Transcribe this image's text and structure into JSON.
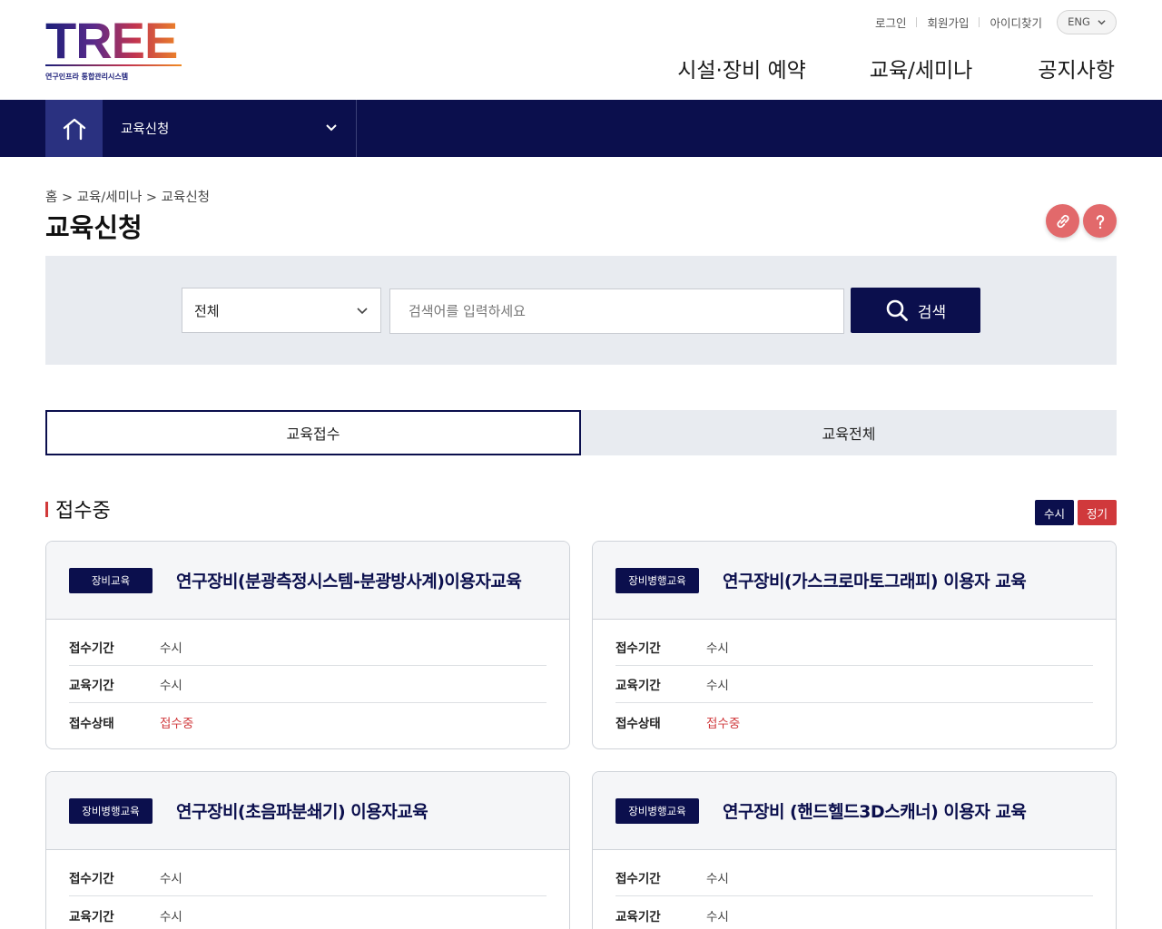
{
  "logo": {
    "word": "TREE",
    "subtitle": "연구인프라 통합관리시스템"
  },
  "util_links": [
    "로그인",
    "회원가입",
    "아이디찾기"
  ],
  "language": "ENG",
  "gnb": [
    "시설·장비 예약",
    "교육/세미나",
    "공지사항"
  ],
  "subnav": {
    "selected": "교육신청"
  },
  "breadcrumb": "홈 > 교육/세미나 > 교육신청",
  "page_title": "교육신청",
  "search": {
    "category": "전체",
    "placeholder": "검색어를 입력하세요",
    "button": "검색"
  },
  "tabs": [
    "교육접수",
    "교육전체"
  ],
  "section": {
    "title": "접수중",
    "legend": [
      "수시",
      "정기"
    ]
  },
  "cards": [
    {
      "tag": "장비교육",
      "title": "연구장비(분광측정시스템-분광방사계)이용자교육",
      "rows": [
        {
          "label": "접수기간",
          "value": "수시"
        },
        {
          "label": "교육기간",
          "value": "수시"
        },
        {
          "label": "접수상태",
          "value": "접수중"
        }
      ]
    },
    {
      "tag": "장비병행교육",
      "title": "연구장비(가스크로마토그래피) 이용자 교육",
      "rows": [
        {
          "label": "접수기간",
          "value": "수시"
        },
        {
          "label": "교육기간",
          "value": "수시"
        },
        {
          "label": "접수상태",
          "value": "접수중"
        }
      ]
    },
    {
      "tag": "장비병행교육",
      "title": "연구장비(초음파분쇄기) 이용자교육",
      "rows": [
        {
          "label": "접수기간",
          "value": "수시"
        },
        {
          "label": "교육기간",
          "value": "수시"
        }
      ]
    },
    {
      "tag": "장비병행교육",
      "title": "연구장비 (핸드헬드3D스캐너) 이용자 교육",
      "rows": [
        {
          "label": "접수기간",
          "value": "수시"
        },
        {
          "label": "교육기간",
          "value": "수시"
        }
      ]
    }
  ],
  "colors": {
    "navy": "#0b0f4d",
    "accent_red": "#d0393c",
    "panel_gray": "#e8ebf0"
  },
  "icons": [
    "home-icon",
    "chevron-down-icon",
    "link-icon",
    "help-icon",
    "search-icon"
  ]
}
